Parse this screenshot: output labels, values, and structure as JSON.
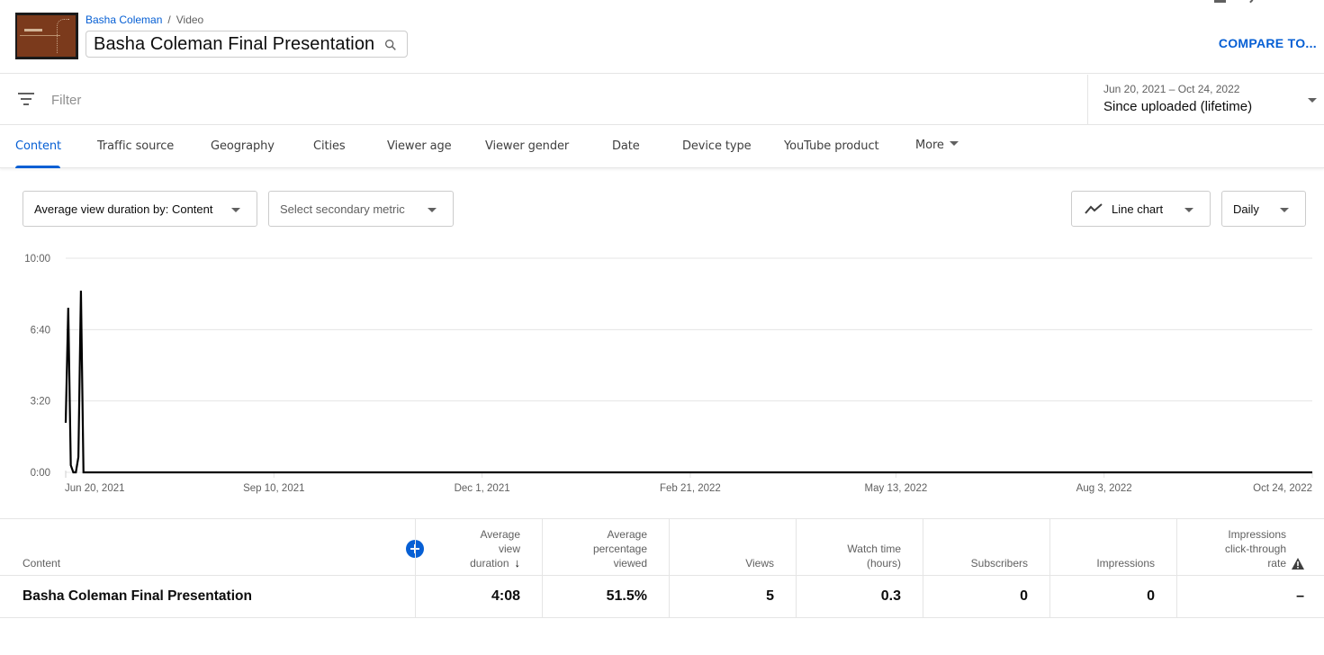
{
  "header": {
    "breadcrumb": {
      "channel": "Basha Coleman",
      "separator": "/",
      "section": "Video"
    },
    "title": "Basha Coleman Final Presentation",
    "compare_label": "COMPARE TO..."
  },
  "filter": {
    "placeholder": "Filter",
    "value": ""
  },
  "date_picker": {
    "range": "Jun 20, 2021 – Oct 24, 2022",
    "period": "Since uploaded (lifetime)"
  },
  "tabs": [
    {
      "label": "Content",
      "active": true
    },
    {
      "label": "Traffic source"
    },
    {
      "label": "Geography"
    },
    {
      "label": "Cities"
    },
    {
      "label": "Viewer age"
    },
    {
      "label": "Viewer gender"
    },
    {
      "label": "Date"
    },
    {
      "label": "Device type"
    },
    {
      "label": "YouTube product"
    },
    {
      "label": "More"
    }
  ],
  "controls": {
    "primary_metric": "Average view duration by: Content",
    "secondary_metric_placeholder": "Select secondary metric",
    "chart_type": "Line chart",
    "granularity": "Daily"
  },
  "chart_data": {
    "type": "line",
    "title": "",
    "xlabel": "",
    "ylabel": "Average view duration",
    "x_start": "2021-06-20",
    "x_end": "2022-10-24",
    "x_tick_labels": [
      "Jun 20, 2021",
      "Sep 10, 2021",
      "Dec 1, 2021",
      "Feb 21, 2022",
      "May 13, 2022",
      "Aug 3, 2022",
      "Oct 24, 2022"
    ],
    "x_tick_days": [
      0,
      82,
      164,
      246,
      327,
      409,
      491
    ],
    "y_tick_labels": [
      "0:00",
      "3:20",
      "6:40",
      "10:00"
    ],
    "y_tick_seconds": [
      0,
      200,
      400,
      600
    ],
    "ylim_seconds": [
      0,
      600
    ],
    "grid": true,
    "legend": "none",
    "series": [
      {
        "name": "Basha Coleman Final Presentation",
        "color": "#000000",
        "unit": "seconds",
        "nonzero_days": [
          {
            "day": 0,
            "value": 139
          },
          {
            "day": 1,
            "value": 461
          },
          {
            "day": 2,
            "value": 20
          },
          {
            "day": 3,
            "value": 0
          },
          {
            "day": 4,
            "value": 0
          },
          {
            "day": 5,
            "value": 43
          },
          {
            "day": 6,
            "value": 509
          },
          {
            "day": 7,
            "value": 0
          }
        ],
        "remaining_days_value": 0,
        "total_days": 492
      }
    ]
  },
  "table": {
    "columns": [
      {
        "label": "Content"
      },
      {
        "label": "Average view duration",
        "lines": [
          "Average",
          "view",
          "duration"
        ],
        "sorted": "desc"
      },
      {
        "label": "Average percentage viewed",
        "lines": [
          "Average",
          "percentage",
          "viewed"
        ]
      },
      {
        "label": "Views",
        "lines": [
          "Views"
        ]
      },
      {
        "label": "Watch time (hours)",
        "lines": [
          "Watch time",
          "(hours)"
        ]
      },
      {
        "label": "Subscribers",
        "lines": [
          "Subscribers"
        ]
      },
      {
        "label": "Impressions",
        "lines": [
          "Impressions"
        ]
      },
      {
        "label": "Impressions click-through rate",
        "lines": [
          "Impressions",
          "click-through",
          "rate"
        ],
        "warning": true
      }
    ],
    "rows": [
      {
        "content": "Basha Coleman Final Presentation",
        "avg_view_duration": "4:08",
        "avg_percentage_viewed": "51.5%",
        "views": "5",
        "watch_time_hours": "0.3",
        "subscribers": "0",
        "impressions": "0",
        "ctr": "–"
      }
    ]
  },
  "colors": {
    "accent": "#065fd4",
    "text": "#0d0d0d",
    "muted": "#606060",
    "border": "#e5e5e5"
  }
}
